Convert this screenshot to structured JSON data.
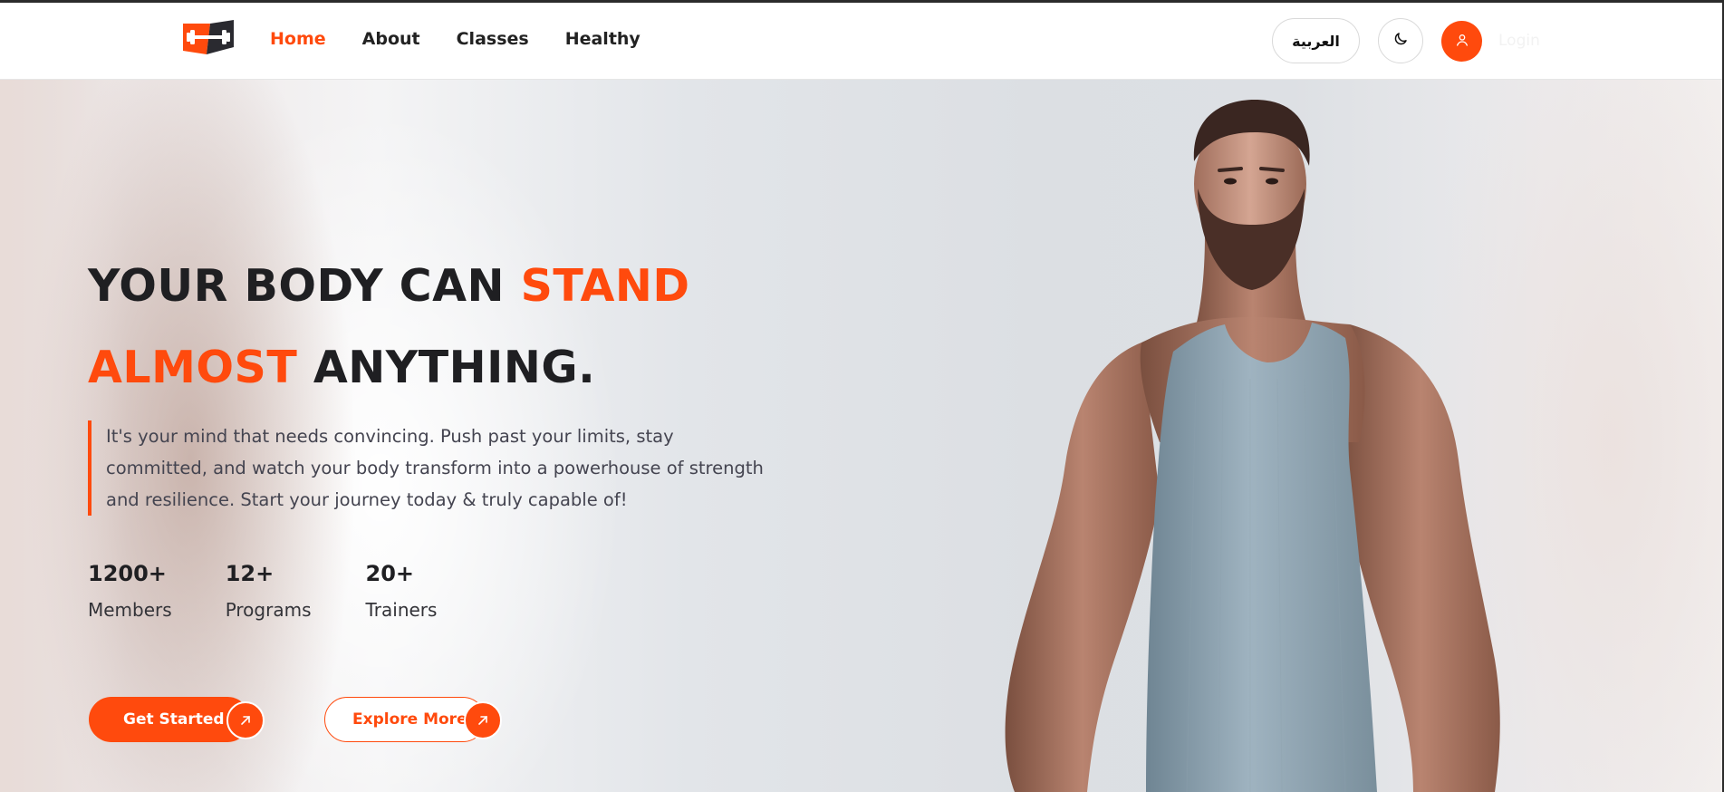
{
  "nav": {
    "logo_name": "gym-logo",
    "links": [
      {
        "label": "Home",
        "active": true
      },
      {
        "label": "About",
        "active": false
      },
      {
        "label": "Classes",
        "active": false
      },
      {
        "label": "Healthy",
        "active": false
      }
    ],
    "language_label": "العربية",
    "theme_icon": "moon-icon",
    "user_icon": "user-icon",
    "login_label": "Login"
  },
  "hero": {
    "headline_part1": "YOUR BODY CAN ",
    "headline_accent1": "STAND",
    "headline_accent2": "ALMOST",
    "headline_part2": " ANYTHING.",
    "description": "It's your mind that needs convincing. Push past your limits, stay committed, and watch your body transform into a powerhouse of strength and resilience. Start your journey today & truly capable of!",
    "stats": [
      {
        "value": "1200+",
        "label": "Members"
      },
      {
        "value": "12+",
        "label": "Programs"
      },
      {
        "value": "20+",
        "label": "Trainers"
      }
    ],
    "primary_button": "Get Started",
    "secondary_button": "Explore More",
    "arrow_icon": "arrow-up-right-icon",
    "image_subject": "muscular bearded man in grey tank top"
  },
  "colors": {
    "accent": "#ff4a0d",
    "text_dark": "#1f1f22",
    "text_body": "#444450"
  }
}
